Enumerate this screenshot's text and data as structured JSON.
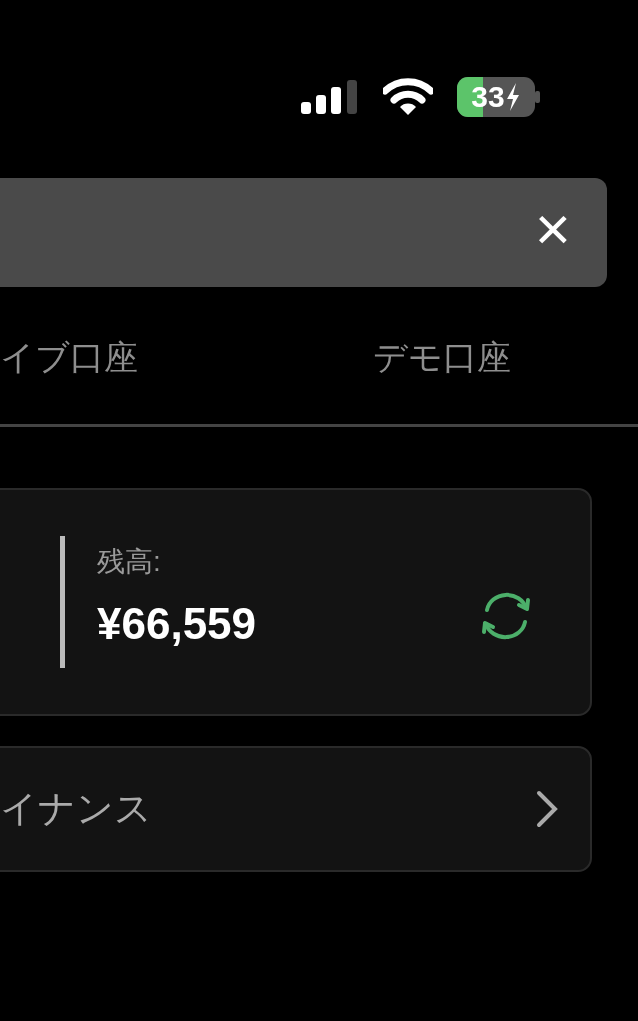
{
  "status_bar": {
    "battery": "33"
  },
  "search": {
    "clear": "×"
  },
  "tabs": [
    {
      "label": "イブ口座",
      "selected": false
    },
    {
      "label": "デモ口座",
      "selected": false
    }
  ],
  "account_card": {
    "balance_label": "残高:",
    "balance": "¥66,559"
  },
  "menu_items": [
    {
      "label": "イナンス"
    }
  ]
}
